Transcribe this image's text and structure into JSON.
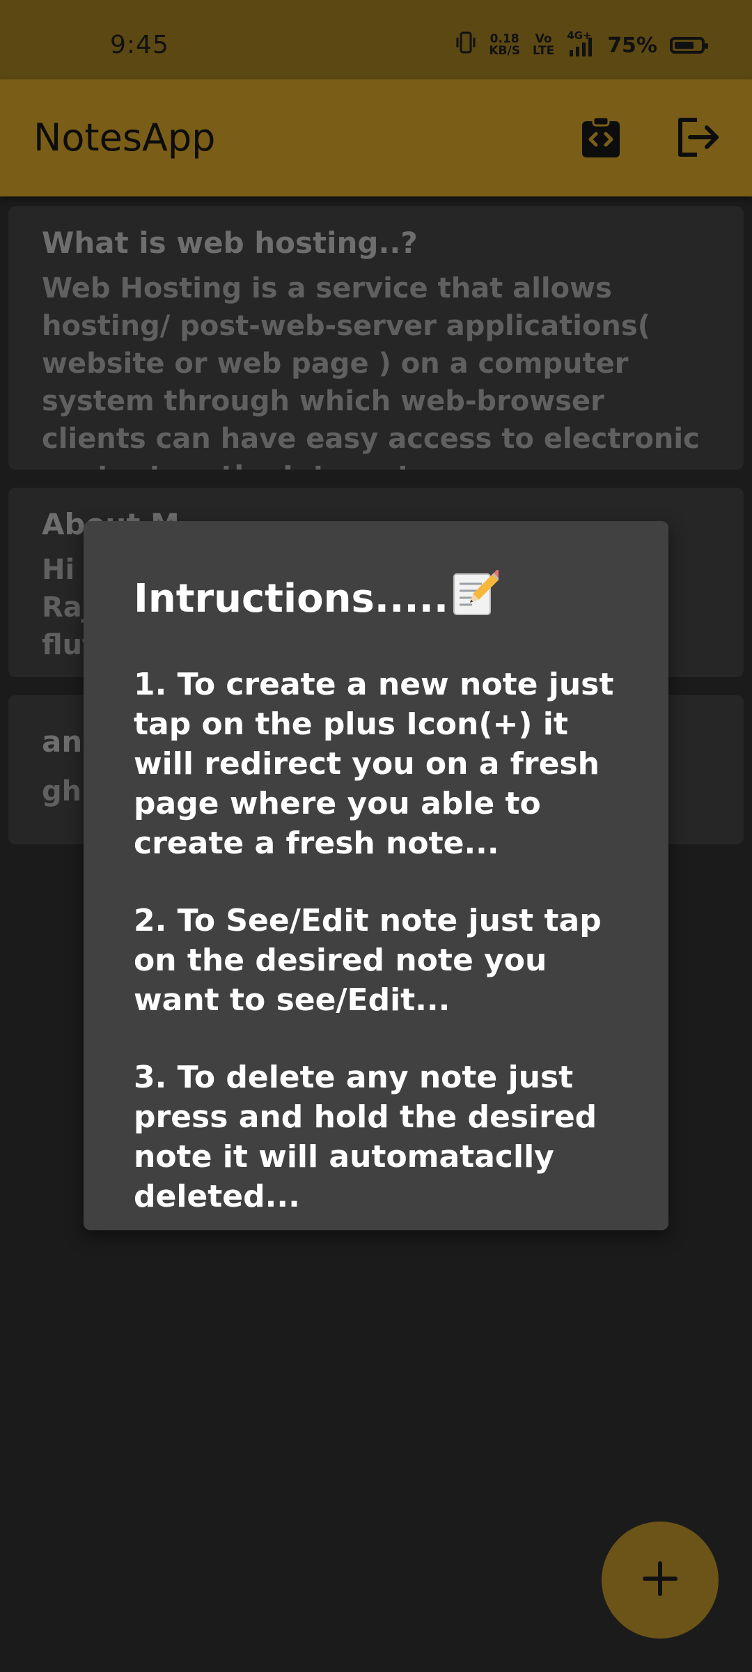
{
  "status_bar": {
    "time": "9:45",
    "net_speed_value": "0.18",
    "net_speed_unit": "KB/S",
    "volte_top": "Vo",
    "volte_bottom": "LTE",
    "network_type": "4G+",
    "battery_percent": "75%",
    "battery_level": 0.75
  },
  "app_bar": {
    "title": "NotesApp",
    "instructions_icon": "clipboard-code-icon",
    "logout_icon": "logout-icon"
  },
  "notes": [
    {
      "title": "What is web hosting..?",
      "body": "Web Hosting is a service that allows hosting/ post-web-server applications( website or web page ) on a computer system through which web-browser clients can have easy access to electronic content on the Internet."
    },
    {
      "title": "About M",
      "body_lines": [
        "Hi r",
        "Raj",
        "flut"
      ]
    },
    {
      "title": "anl",
      "body": "ghb"
    }
  ],
  "dialog": {
    "title": "Intructions.....",
    "title_icon": "memo-pencil-icon",
    "items": [
      "1. To create a new note just tap on the plus Icon(+) it will redirect you on a fresh page where you able to create a fresh note...",
      "2. To See/Edit note just tap on the desired note you want to see/Edit...",
      "3. To delete any note just press and hold the desired note it will automataclly deleted..."
    ]
  },
  "fab": {
    "icon": "plus-icon"
  },
  "colors": {
    "status_bar": "#5c4813",
    "app_bar": "#7a5e17",
    "background": "#1b1b1b",
    "card": "#262626",
    "dialog": "#414141",
    "fab": "#6c5419"
  }
}
